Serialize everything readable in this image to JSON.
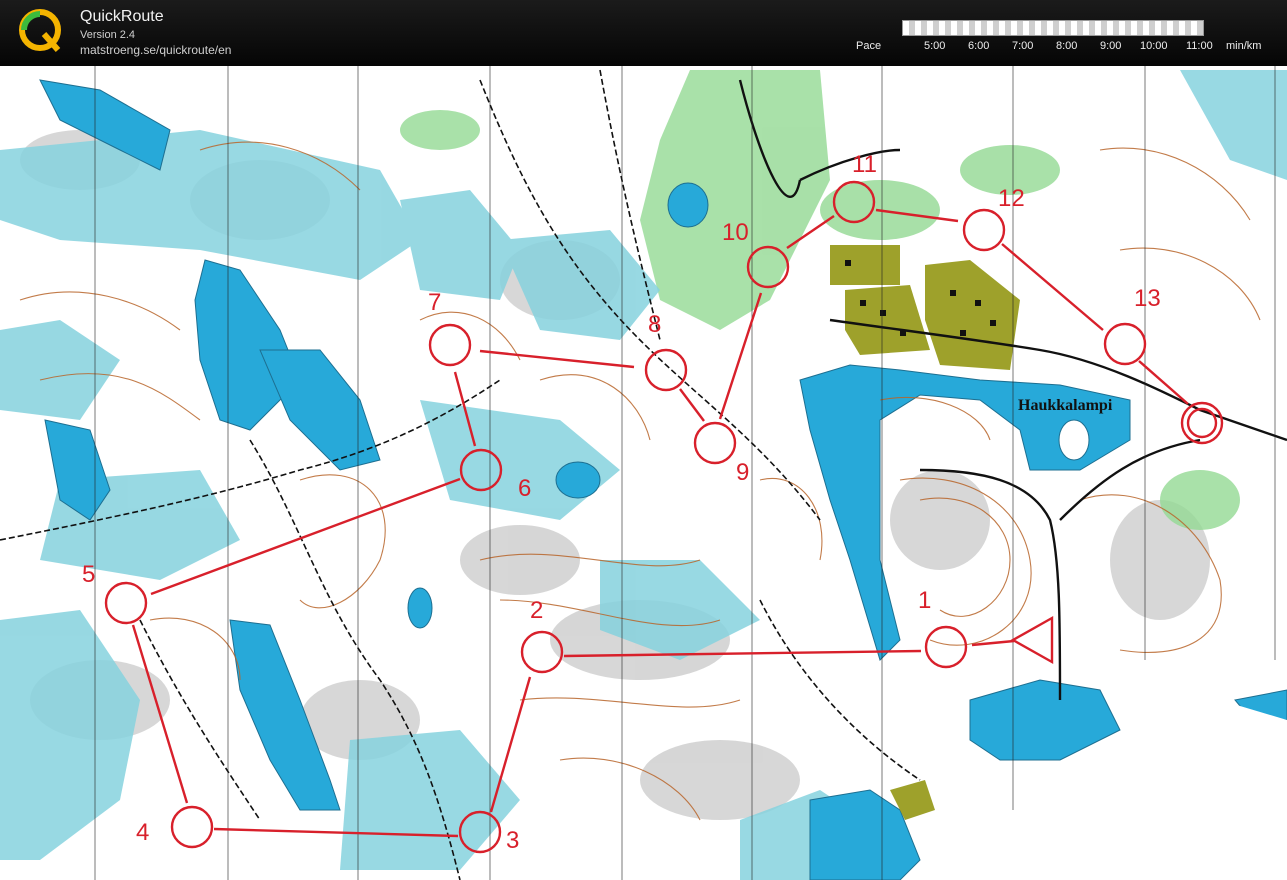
{
  "app": {
    "title": "QuickRoute",
    "version": "Version 2.4",
    "url": "matstroeng.se/quickroute/en",
    "logo_letter": "Q"
  },
  "pace": {
    "label": "Pace",
    "ticks": [
      "5:00",
      "6:00",
      "7:00",
      "8:00",
      "9:00",
      "10:00",
      "11:00"
    ],
    "unit": "min/km"
  },
  "map": {
    "place_name": "Haukkalampi",
    "controls": [
      {
        "label": "1"
      },
      {
        "label": "2"
      },
      {
        "label": "3"
      },
      {
        "label": "4"
      },
      {
        "label": "5"
      },
      {
        "label": "6"
      },
      {
        "label": "7"
      },
      {
        "label": "8"
      },
      {
        "label": "9"
      },
      {
        "label": "10"
      },
      {
        "label": "11"
      },
      {
        "label": "12"
      },
      {
        "label": "13"
      }
    ],
    "colors": {
      "course": "#d8202b",
      "water": "#27a9d9",
      "marsh": "#7fd3dc",
      "forest_green": "#8fd68f",
      "settlement": "#9a9e2a",
      "contour": "#b8652a",
      "rock": "#b9b9b9",
      "path": "#111111"
    }
  }
}
